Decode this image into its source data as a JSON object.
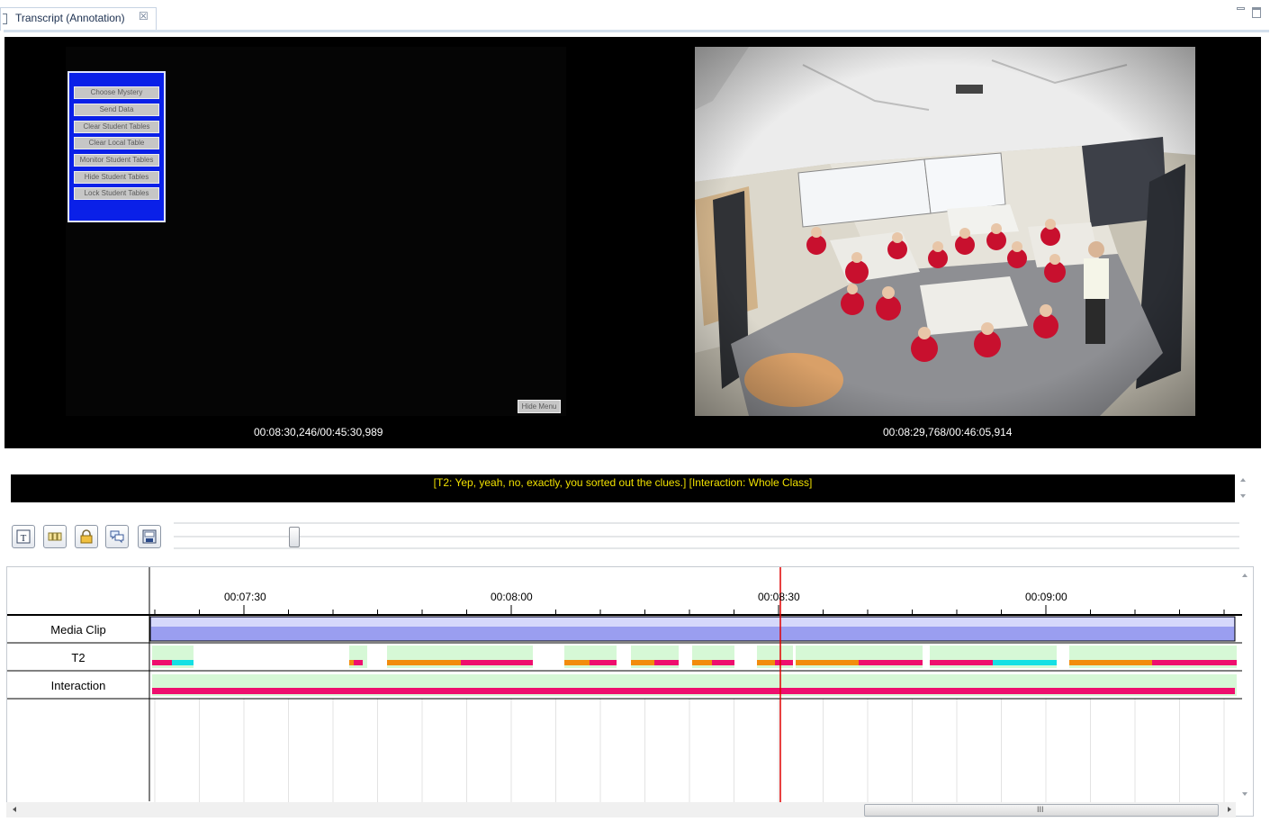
{
  "tab": {
    "title": "Transcript (Annotation)",
    "close_glyph": "☒"
  },
  "left_video": {
    "menu_buttons": [
      "Choose Mystery",
      "Send Data",
      "Clear Student Tables",
      "Clear Local Table",
      "Monitor Student Tables",
      "Hide Student Tables",
      "Lock Student Tables"
    ],
    "hide_menu_label": "Hide Menu",
    "timecode": "00:08:30,246/00:45:30,989"
  },
  "right_video": {
    "timecode": "00:08:29,768/00:46:05,914"
  },
  "caption": {
    "text": "[T2: Yep, yeah, no, exactly, you sorted out the clues.] [Interaction: Whole Class]",
    "color": "#f0e000"
  },
  "toolbar": {
    "buttons": [
      "text-icon",
      "grid-icon",
      "lock-icon",
      "speech-bubbles-icon",
      "save-image-icon"
    ]
  },
  "timeline": {
    "time_labels": [
      "00:07:30",
      "00:08:00",
      "00:08:30",
      "00:09:00"
    ],
    "tracks": [
      "Media Clip",
      "T2",
      "Interaction"
    ],
    "colors": {
      "media_clip": "#9a9ef0",
      "orange": "#f28c0c",
      "magenta": "#ee0f6e",
      "cyan": "#14e0e4",
      "light_green": "#d6f8d6",
      "playhead": "#e00000"
    }
  }
}
